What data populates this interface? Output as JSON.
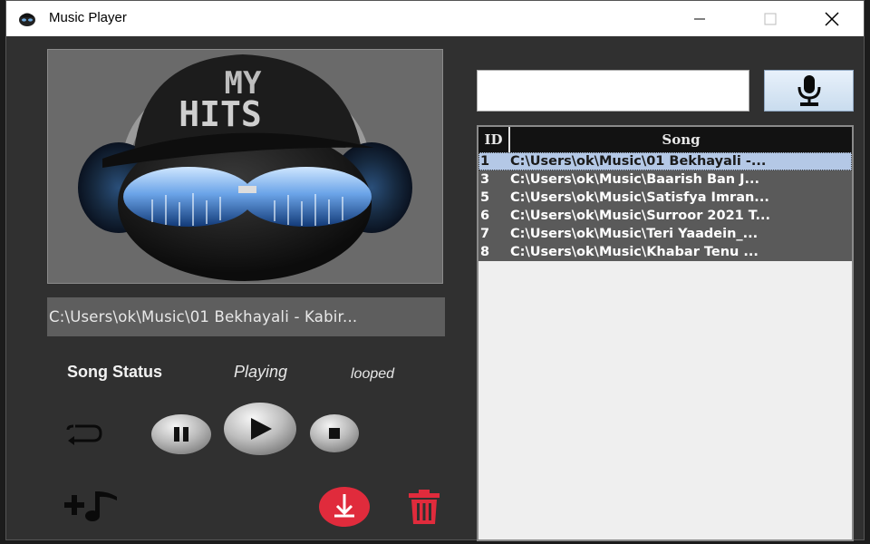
{
  "window": {
    "title": "Music Player"
  },
  "now_playing": {
    "path": "C:\\Users\\ok\\Music\\01 Bekhayali - Kabir..."
  },
  "status": {
    "label": "Song Status",
    "state": "Playing",
    "loop": "looped"
  },
  "search": {
    "value": "",
    "placeholder": ""
  },
  "playlist": {
    "headers": {
      "id": "ID",
      "song": "Song"
    },
    "rows": [
      {
        "id": "1",
        "song": "C:\\Users\\ok\\Music\\01 Bekhayali -..."
      },
      {
        "id": "3",
        "song": "C:\\Users\\ok\\Music\\Baarish Ban J..."
      },
      {
        "id": "5",
        "song": "C:\\Users\\ok\\Music\\Satisfya Imran..."
      },
      {
        "id": "6",
        "song": "C:\\Users\\ok\\Music\\Surroor 2021 T..."
      },
      {
        "id": "7",
        "song": "C:\\Users\\ok\\Music\\Teri Yaadein_..."
      },
      {
        "id": "8",
        "song": "C:\\Users\\ok\\Music\\Khabar Tenu ..."
      }
    ],
    "selected_index": 0
  },
  "album_art": {
    "text_line1": "MY",
    "text_line2": "HITS"
  },
  "icons": {
    "loop": "loop-icon",
    "pause": "pause-icon",
    "play": "play-icon",
    "stop": "stop-icon",
    "add_song": "add-music-icon",
    "download": "download-icon",
    "delete": "trash-icon",
    "mic": "microphone-icon"
  },
  "colors": {
    "window_bg": "#303030",
    "selected_row": "#b4c8e6",
    "row_bg": "#5a5a5a",
    "header_bg": "#121212",
    "accent_red": "#e02b3c"
  }
}
